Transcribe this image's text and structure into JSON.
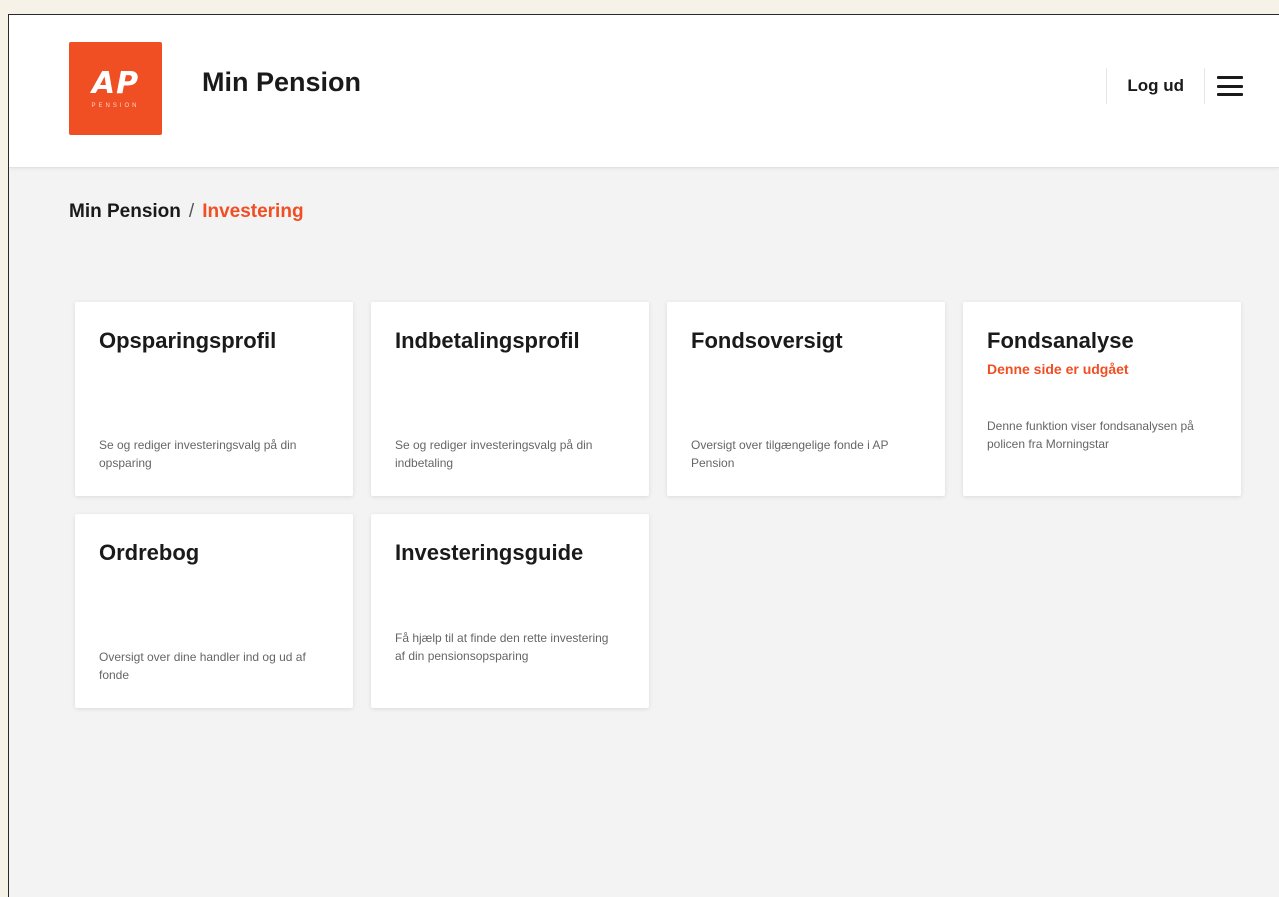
{
  "header": {
    "logo_text": "AP",
    "logo_subtext": "PENSION",
    "title": "Min Pension",
    "logout_label": "Log ud"
  },
  "breadcrumb": {
    "parent": "Min Pension",
    "separator": "/",
    "current": "Investering"
  },
  "cards": [
    {
      "title": "Opsparingsprofil",
      "note": "",
      "description": "Se og rediger investeringsvalg på din opsparing"
    },
    {
      "title": "Indbetalingsprofil",
      "note": "",
      "description": "Se og rediger investeringsvalg på din indbetaling"
    },
    {
      "title": "Fondsoversigt",
      "note": "",
      "description": "Oversigt over tilgængelige fonde i AP Pension"
    },
    {
      "title": "Fondsanalyse",
      "note": "Denne side er udgået",
      "description": "Denne funktion viser fondsanalysen på policen fra Morningstar"
    },
    {
      "title": "Ordrebog",
      "note": "",
      "description": "Oversigt over dine handler ind og ud af fonde"
    },
    {
      "title": "Investeringsguide",
      "note": "",
      "description": "Få hjælp til at finde den rette investering af din pensionsopsparing"
    }
  ],
  "colors": {
    "brand": "#f04e23",
    "background": "#f3f3f3",
    "card": "#ffffff",
    "text": "#1a1a1a",
    "muted_text": "#666666"
  },
  "icons": {
    "menu": "hamburger-menu-icon"
  }
}
